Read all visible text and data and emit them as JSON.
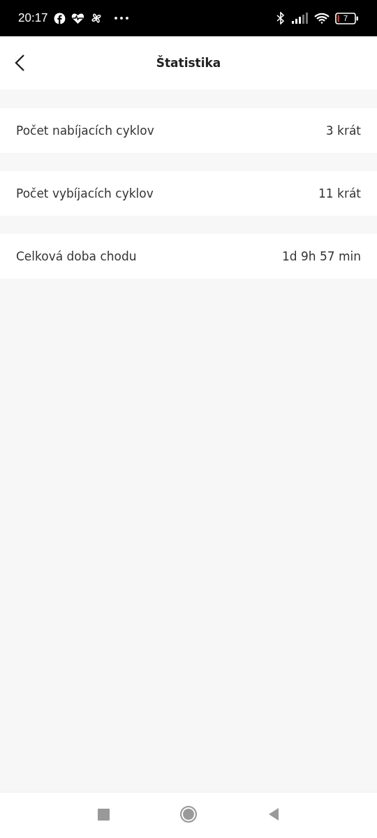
{
  "status_bar": {
    "time": "20:17",
    "battery": "7"
  },
  "header": {
    "title": "Štatistika"
  },
  "rows": [
    {
      "label": "Počet nabíjacích cyklov",
      "value": "3 krát"
    },
    {
      "label": "Počet vybíjacích cyklov",
      "value": "11 krát"
    },
    {
      "label": "Celková doba chodu",
      "value": "1d 9h 57 min"
    }
  ]
}
